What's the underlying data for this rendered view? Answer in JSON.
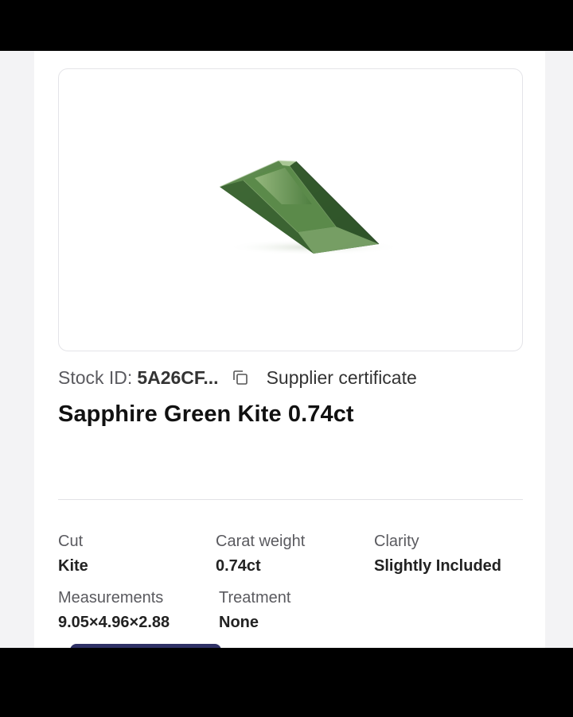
{
  "product": {
    "stock_label": "Stock ID:",
    "stock_id": "5A26CF...",
    "certificate_link": "Supplier certificate",
    "title": "Sapphire Green Kite 0.74ct"
  },
  "specs": [
    {
      "label": "Cut",
      "value": "Kite"
    },
    {
      "label": "Carat weight",
      "value": "0.74ct"
    },
    {
      "label": "Clarity",
      "value": "Slightly Included"
    },
    {
      "label": "Measurements",
      "value": "9.05×4.96×2.88"
    },
    {
      "label": "Treatment",
      "value": "None"
    }
  ],
  "icons": {
    "copy": "copy-icon",
    "gem": "gemstone-image"
  },
  "colors": {
    "gem_dark": "#2f5a2c",
    "gem_mid": "#4e7f3e",
    "gem_light": "#8fb07a",
    "accent_button": "#2f3166"
  }
}
